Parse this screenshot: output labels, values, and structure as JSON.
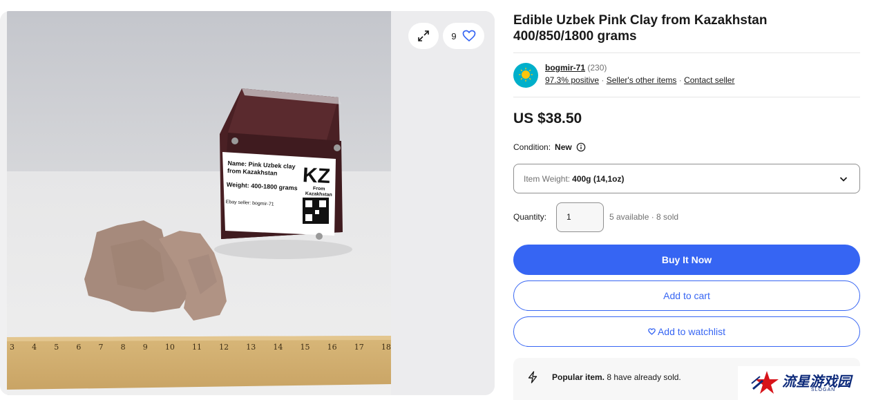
{
  "gallery": {
    "watch_count": "9",
    "expand_icon": "expand-arrows-icon",
    "heart_icon": "heart-icon",
    "photo_label": {
      "name_line1": "Name: Pink Uzbek clay",
      "name_line2": "from Kazakhstan",
      "weight": "Weight: 400-1800 grams",
      "seller": "Ebay seller: bogmir-71",
      "country_code": "KZ",
      "from_line1": "From",
      "from_line2": "Kazakhstan"
    },
    "ruler_numbers": [
      "3",
      "4",
      "5",
      "6",
      "7",
      "8",
      "9",
      "10",
      "11",
      "12",
      "13",
      "14",
      "15",
      "16",
      "17",
      "18"
    ]
  },
  "listing": {
    "title": "Edible Uzbek Pink Clay from Kazakhstan 400/850/1800 grams",
    "price": "US $38.50"
  },
  "seller": {
    "name": "bogmir-71",
    "feedback_count": "(230)",
    "positive": "97.3% positive",
    "separator": "·",
    "other_items": "Seller's other items",
    "contact": "Contact seller"
  },
  "condition": {
    "label": "Condition:",
    "value": "New"
  },
  "variation": {
    "label": "Item Weight:",
    "value": "400g (14,1oz)"
  },
  "quantity": {
    "label": "Quantity:",
    "value": "1",
    "availability": "5 available · 8 sold"
  },
  "actions": {
    "buy_now": "Buy It Now",
    "add_to_cart": "Add to cart",
    "add_to_watchlist": "Add to watchlist"
  },
  "highlights": {
    "popular_label": "Popular item.",
    "popular_text": "8 have already sold."
  },
  "watermark": {
    "text": "流星游戏园",
    "sub": "SLOGAN"
  },
  "colors": {
    "accent": "#3665f3",
    "text": "#191919",
    "muted": "#707070",
    "gallery_bg": "#f0f0f1"
  }
}
